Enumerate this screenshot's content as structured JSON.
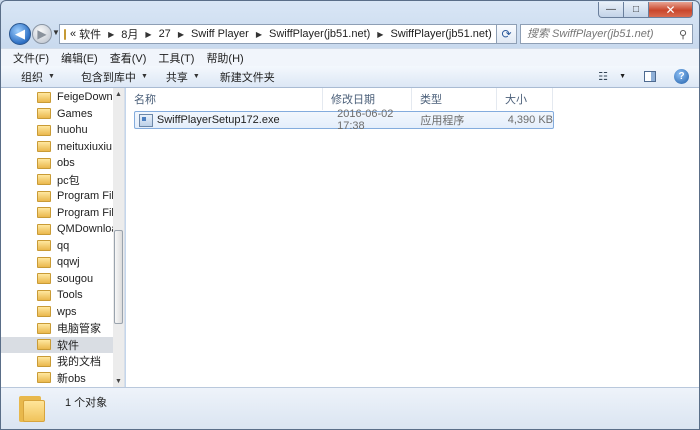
{
  "window": {
    "caption": {
      "minimize": "—",
      "maximize": "□",
      "close": "✕"
    }
  },
  "nav": {
    "back_icon": "back-arrow-icon",
    "forward_icon": "forward-arrow-icon",
    "breadcrumb_prefix": "«",
    "breadcrumb": [
      "软件",
      "8月",
      "27",
      "Swiff Player",
      "SwiffPlayer(jb51.net)",
      "SwiffPlayer(jb51.net)"
    ],
    "search_placeholder": "搜索 SwiffPlayer(jb51.net)"
  },
  "menubar": [
    "文件(F)",
    "编辑(E)",
    "查看(V)",
    "工具(T)",
    "帮助(H)"
  ],
  "toolbar": {
    "organize": "组织",
    "include_library": "包含到库中",
    "share": "共享",
    "new_folder": "新建文件夹"
  },
  "sidebar": {
    "items": [
      {
        "label": "FeigeDownload",
        "selected": false
      },
      {
        "label": "Games",
        "selected": false
      },
      {
        "label": "huohu",
        "selected": false
      },
      {
        "label": "meituxiuxiu",
        "selected": false
      },
      {
        "label": "obs",
        "selected": false
      },
      {
        "label": "pc包",
        "selected": false
      },
      {
        "label": "Program Files",
        "selected": false
      },
      {
        "label": "Program Files",
        "selected": false
      },
      {
        "label": "QMDownload",
        "selected": false
      },
      {
        "label": "qq",
        "selected": false
      },
      {
        "label": "qqwj",
        "selected": false
      },
      {
        "label": "sougou",
        "selected": false
      },
      {
        "label": "Tools",
        "selected": false
      },
      {
        "label": "wps",
        "selected": false
      },
      {
        "label": "电脑管家",
        "selected": false
      },
      {
        "label": "软件",
        "selected": true
      },
      {
        "label": "我的文档",
        "selected": false
      },
      {
        "label": "新obs",
        "selected": false
      }
    ]
  },
  "columns": {
    "name": "名称",
    "date": "修改日期",
    "type": "类型",
    "size": "大小"
  },
  "files": [
    {
      "name": "SwiffPlayerSetup172.exe",
      "date": "2016-06-02 17:38",
      "type": "应用程序",
      "size": "4,390 KB"
    }
  ],
  "status": {
    "count": "1 个对象"
  },
  "colors": {
    "accent": "#2d6fc3",
    "selection": "#d9dde3",
    "row_highlight": "#e4eefb"
  }
}
